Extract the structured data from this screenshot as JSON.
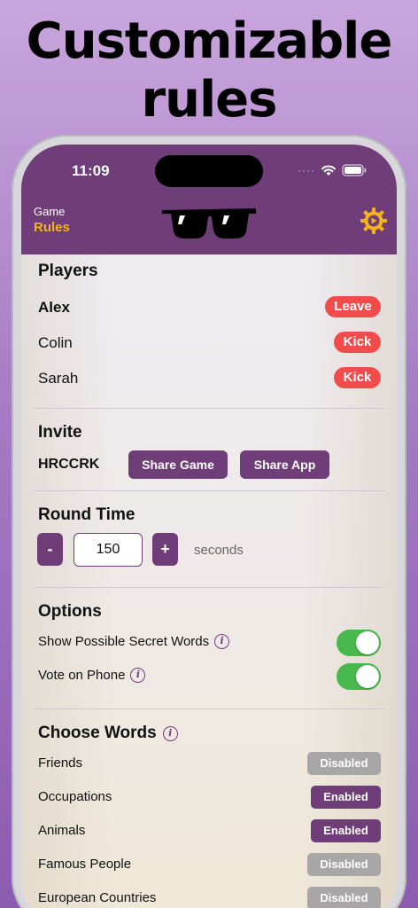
{
  "promo": {
    "line1": "Customizable",
    "line2": "rules"
  },
  "status_bar": {
    "time": "11:09",
    "signal_dots": "····"
  },
  "nav": {
    "small_label": "Game",
    "title": "Rules"
  },
  "sections": {
    "players": {
      "title": "Players",
      "items": [
        {
          "name": "Alex",
          "action": "Leave",
          "is_self": true
        },
        {
          "name": "Colin",
          "action": "Kick",
          "is_self": false
        },
        {
          "name": "Sarah",
          "action": "Kick",
          "is_self": false
        }
      ]
    },
    "invite": {
      "title": "Invite",
      "code": "HRCCRK",
      "share_game_label": "Share Game",
      "share_app_label": "Share App"
    },
    "round_time": {
      "title": "Round Time",
      "minus_label": "-",
      "plus_label": "+",
      "value": "150",
      "unit": "seconds"
    },
    "options": {
      "title": "Options",
      "items": [
        {
          "label": "Show Possible Secret Words",
          "enabled": true
        },
        {
          "label": "Vote on Phone",
          "enabled": true
        }
      ]
    },
    "choose_words": {
      "title": "Choose Words",
      "items": [
        {
          "label": "Friends",
          "state": "Disabled"
        },
        {
          "label": "Occupations",
          "state": "Enabled"
        },
        {
          "label": "Animals",
          "state": "Enabled"
        },
        {
          "label": "Famous People",
          "state": "Disabled"
        },
        {
          "label": "European Countries",
          "state": "Disabled"
        }
      ]
    }
  },
  "info_glyph": "i",
  "colors": {
    "brand_purple": "#6f3d78",
    "accent_gold": "#f5b21a",
    "danger_red": "#f24b4b",
    "toggle_green": "#47b84e",
    "disabled_gray": "#a8a6a6"
  }
}
